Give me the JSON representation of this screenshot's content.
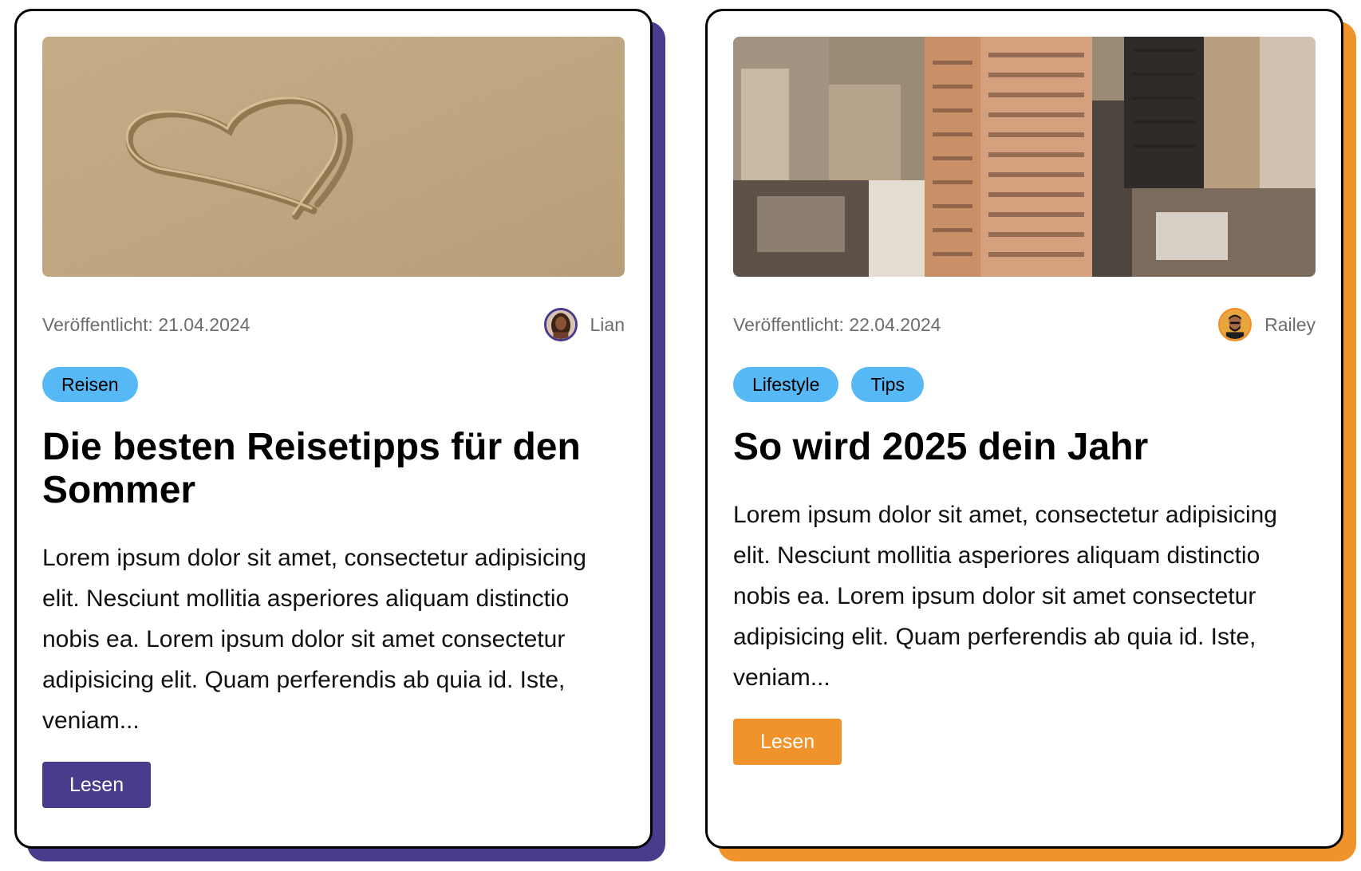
{
  "cards": [
    {
      "image_alt": "Herz im Sand",
      "date_text": "Veröffentlicht: 21.04.2024",
      "author": "Lian",
      "tags": [
        "Reisen"
      ],
      "title": "Die besten Reisetipps für den Sommer",
      "excerpt": "Lorem ipsum dolor sit amet, consectetur adipisicing elit. Nesciunt mollitia asperiores aliquam distinctio nobis ea. Lorem ipsum dolor sit amet consectetur adipisicing elit. Quam perferendis ab quia id. Iste, veniam...",
      "button_label": "Lesen",
      "accent_color": "#4a3b8c"
    },
    {
      "image_alt": "Stadtansicht mit Hochhäusern",
      "date_text": "Veröffentlicht: 22.04.2024",
      "author": "Railey",
      "tags": [
        "Lifestyle",
        "Tips"
      ],
      "title": "So wird 2025 dein Jahr",
      "excerpt": "Lorem ipsum dolor sit amet, consectetur adipisicing elit. Nesciunt mollitia asperiores aliquam distinctio nobis ea. Lorem ipsum dolor sit amet consectetur adipisicing elit. Quam perferendis ab quia id. Iste, veniam...",
      "button_label": "Lesen",
      "accent_color": "#f0932b"
    }
  ],
  "tag_color": "#56b9f5"
}
